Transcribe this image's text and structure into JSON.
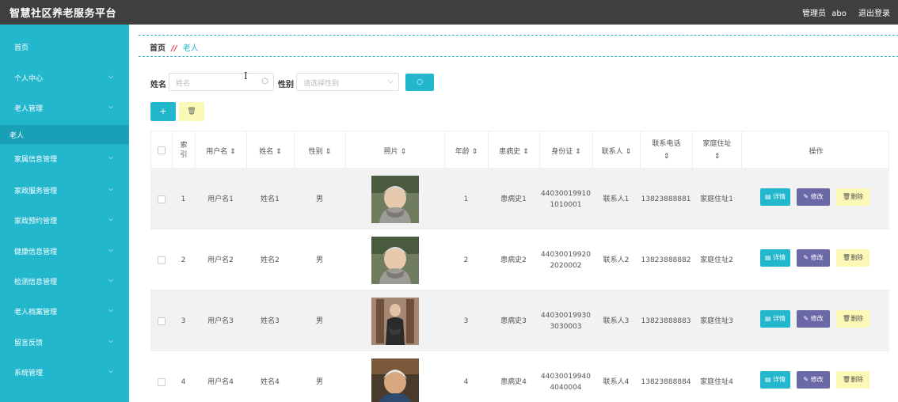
{
  "app": {
    "title": "智慧社区养老服务平台"
  },
  "topbar": {
    "role": "管理员",
    "user": "abo",
    "logout": "退出登录"
  },
  "sidebar": {
    "items": [
      {
        "label": "首页",
        "expandable": false
      },
      {
        "label": "个人中心",
        "expandable": true
      },
      {
        "label": "老人管理",
        "expandable": true
      },
      {
        "label": "老人",
        "expandable": false,
        "sub": true
      },
      {
        "label": "家属信息管理",
        "expandable": true
      },
      {
        "label": "家政服务管理",
        "expandable": true
      },
      {
        "label": "家政预约管理",
        "expandable": true
      },
      {
        "label": "健康信息管理",
        "expandable": true
      },
      {
        "label": "检测信息管理",
        "expandable": true
      },
      {
        "label": "老人档案管理",
        "expandable": true
      },
      {
        "label": "留言反馈",
        "expandable": true
      },
      {
        "label": "系统管理",
        "expandable": true
      }
    ]
  },
  "breadcrumb": {
    "home": "首页",
    "separator": "//",
    "current": "老人"
  },
  "search": {
    "name_label": "姓名",
    "name_placeholder": "姓名",
    "gender_label": "性别",
    "gender_placeholder": "请选择性别",
    "search_icon": "search-icon"
  },
  "toolbar": {
    "add_label": "+",
    "delete_icon": "trash-icon"
  },
  "table": {
    "columns": [
      "",
      "索引",
      "用户名 ⇕",
      "姓名 ⇕",
      "性别 ⇕",
      "照片 ⇕",
      "年龄 ⇕",
      "患病史 ⇕",
      "身份证 ⇕",
      "联系人 ⇕",
      "联系电话 ⇕",
      "家庭住址 ⇕",
      "操作"
    ],
    "rows": [
      {
        "index": "1",
        "username": "用户名1",
        "name": "姓名1",
        "gender": "男",
        "age": "1",
        "history": "患病史1",
        "id_line1": "44030019910",
        "id_line2": "1010001",
        "contact": "联系人1",
        "phone": "13823888881",
        "address": "家庭住址1"
      },
      {
        "index": "2",
        "username": "用户名2",
        "name": "姓名2",
        "gender": "男",
        "age": "2",
        "history": "患病史2",
        "id_line1": "44030019920",
        "id_line2": "2020002",
        "contact": "联系人2",
        "phone": "13823888882",
        "address": "家庭住址2"
      },
      {
        "index": "3",
        "username": "用户名3",
        "name": "姓名3",
        "gender": "男",
        "age": "3",
        "history": "患病史3",
        "id_line1": "44030019930",
        "id_line2": "3030003",
        "contact": "联系人3",
        "phone": "13823888883",
        "address": "家庭住址3"
      },
      {
        "index": "4",
        "username": "用户名4",
        "name": "姓名4",
        "gender": "男",
        "age": "4",
        "history": "患病史4",
        "id_line1": "44030019940",
        "id_line2": "4040004",
        "contact": "联系人4",
        "phone": "13823888884",
        "address": "家庭住址4"
      }
    ],
    "actions": {
      "detail": "详情",
      "edit": "修改",
      "delete": "删除"
    }
  },
  "colors": {
    "accent": "#23b7ce",
    "topbar": "#3f3f3f",
    "edit": "#6b68a8",
    "delete": "#fcf8b6"
  }
}
